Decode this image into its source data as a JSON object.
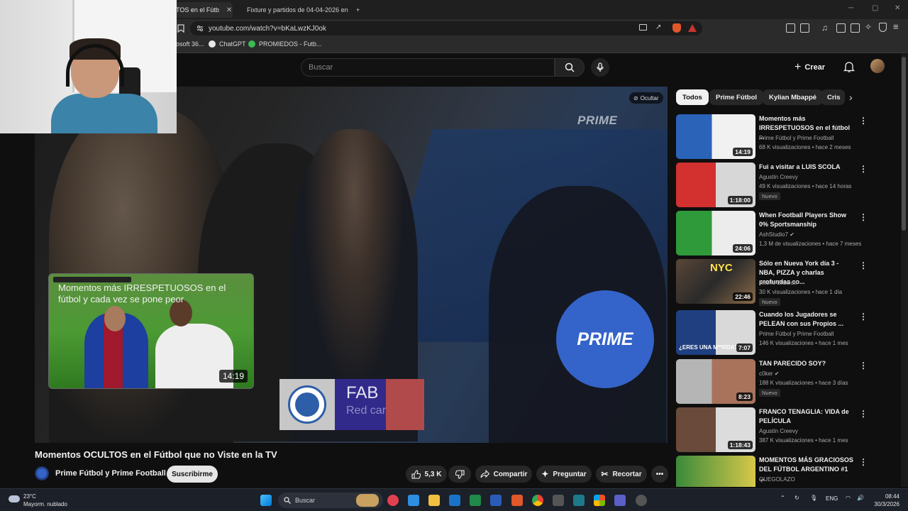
{
  "browser": {
    "tabs": [
      {
        "label": "TOS en el Fútb",
        "active": true
      },
      {
        "label": "Fixture y partidos de 04-04-2026 en",
        "active": false
      }
    ],
    "new_tab": "+",
    "url": "youtube.com/watch?v=bKaLwzKJ0ok",
    "bookmarks": [
      {
        "label": "osoft 36..."
      },
      {
        "label": "ChatGPT"
      },
      {
        "label": "PROMIEDOS - Futb..."
      }
    ]
  },
  "header": {
    "search_placeholder": "Buscar",
    "create_label": "Crear"
  },
  "player": {
    "hide_label": "Ocultar",
    "watermark": "PRIME",
    "circle_logo": "PRIME",
    "endcard": {
      "title": "Momentos más IRRESPETUOSOS en el fútbol y cada vez se pone peor",
      "duration": "14:19"
    },
    "lower_third": {
      "name": "FAB",
      "sub": "Red car"
    }
  },
  "video": {
    "title": "Momentos OCULTOS en el Fútbol que no Viste en la TV",
    "channel": "Prime Fútbol y Prime Football",
    "subscribe": "Suscribirme",
    "likes": "5,3 K",
    "share": "Compartir",
    "ask": "Preguntar",
    "clip": "Recortar"
  },
  "sidebar": {
    "chips": [
      "Todos",
      "Prime Fútbol",
      "Kylian Mbappé",
      "Cris"
    ],
    "recommendations": [
      {
        "title": "Momentos más IRRESPETUOSOS en el fútbol ...",
        "channel": "Prime Fútbol y Prime Football",
        "meta": "68 K visualizaciones • hace 2 meses",
        "duration": "14:19",
        "badge": ""
      },
      {
        "title": "Fui a visitar a LUIS SCOLA",
        "channel": "Agustín Creevy",
        "meta": "49 K visualizaciones • hace 14 horas",
        "duration": "1:18:00",
        "badge": "Nuevo"
      },
      {
        "title": "When Football Players Show 0% Sportsmanship",
        "channel": "AshStudio7",
        "meta": "1,3 M de visualizaciones • hace 7 meses",
        "duration": "24:06",
        "badge": ""
      },
      {
        "title": "Sólo en Nueva York día 3 - NBA, PIZZA y charlas profundas co...",
        "channel": "Nacho Elizalde",
        "meta": "30 K visualizaciones • hace 1 día",
        "duration": "22:46",
        "badge": "Nuevo"
      },
      {
        "title": "Cuando los Jugadores se PELEAN con sus Propios ...",
        "channel": "Prime Fútbol y Prime Football",
        "meta": "146 K visualizaciones • hace 1 mes",
        "duration": "7:07",
        "badge": ""
      },
      {
        "title": "TAN PARECIDO SOY?",
        "channel": "c0ker",
        "meta": "188 K visualizaciones • hace 3 días",
        "duration": "8:23",
        "badge": "Nuevo"
      },
      {
        "title": "FRANCO TENAGLIA: VIDA de PELÍCULA",
        "channel": "Agustín Creevy",
        "meta": "387 K visualizaciones • hace 1 mes",
        "duration": "1:18:43",
        "badge": ""
      },
      {
        "title": "MOMENTOS MÁS GRACIOSOS DEL FÚTBOL ARGENTINO #1 ...",
        "channel": "QUEGOLAZO",
        "meta": "",
        "duration": "",
        "badge": ""
      }
    ],
    "thumb_texts": {
      "r2": "¿ERES UNA M**RDA?",
      "r3": "NYC"
    }
  },
  "taskbar": {
    "weather_temp": "23°C",
    "weather_desc": "Mayorm. nublado",
    "search": "Buscar",
    "lang": "ENG",
    "time": "08:44",
    "date": "30/3/2026"
  }
}
